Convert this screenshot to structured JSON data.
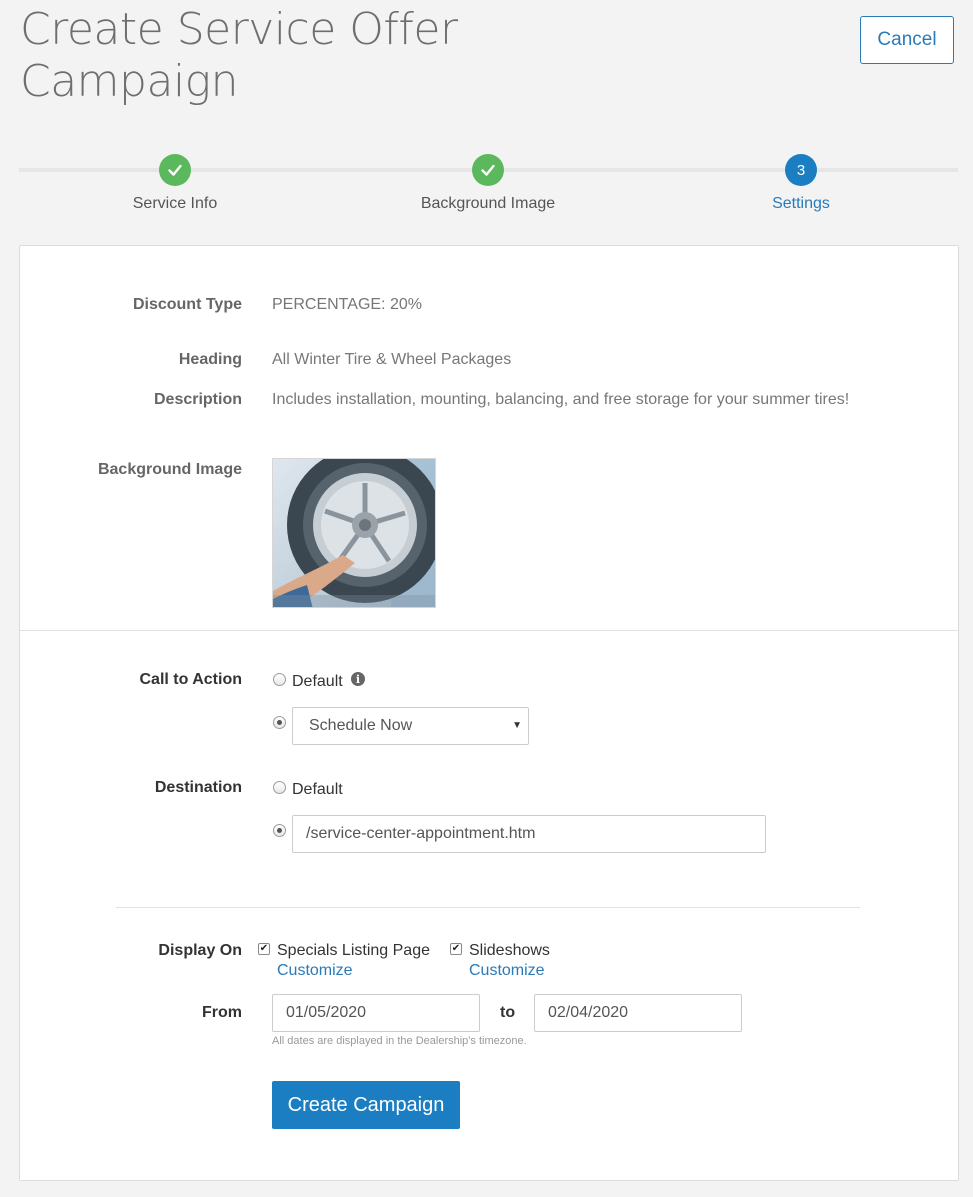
{
  "header": {
    "title": "Create Service Offer Campaign",
    "cancel_label": "Cancel"
  },
  "stepper": {
    "steps": [
      {
        "label": "Service Info",
        "status": "complete",
        "icon": "check-icon"
      },
      {
        "label": "Background Image",
        "status": "complete",
        "icon": "check-icon"
      },
      {
        "label": "Settings",
        "status": "active",
        "number": "3"
      }
    ]
  },
  "summary": {
    "discount_type_label": "Discount Type",
    "discount_type_value": "PERCENTAGE: 20%",
    "heading_label": "Heading",
    "heading_value": "All Winter Tire & Wheel Packages",
    "description_label": "Description",
    "description_value": "Includes installation, mounting, balancing, and free storage for your summer tires!",
    "background_image_label": "Background Image"
  },
  "call_to_action": {
    "label": "Call to Action",
    "default_label": "Default",
    "info_icon": "info-icon",
    "selected_option": "Schedule Now"
  },
  "destination": {
    "label": "Destination",
    "default_label": "Default",
    "url_value": "/service-center-appointment.htm"
  },
  "display_on": {
    "label": "Display On",
    "options": [
      {
        "label": "Specials Listing Page",
        "checked": true,
        "customize_label": "Customize"
      },
      {
        "label": "Slideshows",
        "checked": true,
        "customize_label": "Customize"
      }
    ]
  },
  "dates": {
    "from_label": "From",
    "from_value": "01/05/2020",
    "to_label": "to",
    "to_value": "02/04/2020",
    "hint": "All dates are displayed in the Dealership's timezone."
  },
  "submit_label": "Create Campaign",
  "colors": {
    "primary": "#1b7ec3",
    "success": "#5cb85c",
    "background": "#f3f3f3"
  }
}
